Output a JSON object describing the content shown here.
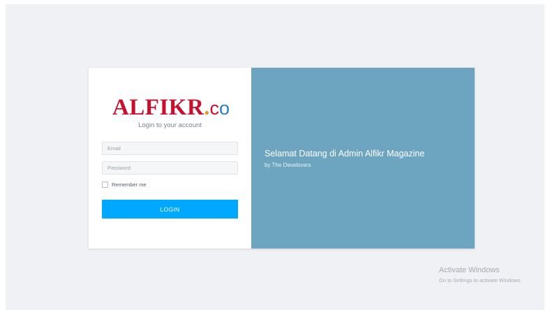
{
  "logo": {
    "main": "ALFIKR",
    "dot": ".",
    "c": "c",
    "o": "o"
  },
  "login": {
    "subtitle": "Login to your account",
    "email_placeholder": "Email",
    "password_placeholder": "Password",
    "remember_label": "Remember me",
    "remember_checked": false,
    "button_label": "LOGIN"
  },
  "welcome": {
    "title": "Selamat Datang di Admin Alfikr Magazine",
    "subtitle": "by The Develovers"
  },
  "watermark": {
    "title": "Activate Windows",
    "subtitle": "Go to Settings to activate Windows."
  },
  "colors": {
    "background": "#f0f1f4",
    "brand_red": "#c8102e",
    "brand_blue": "#2a7fc8",
    "brand_gold": "#d9a21b",
    "button": "#00a8ff",
    "welcome_panel": "#6da5c1"
  }
}
